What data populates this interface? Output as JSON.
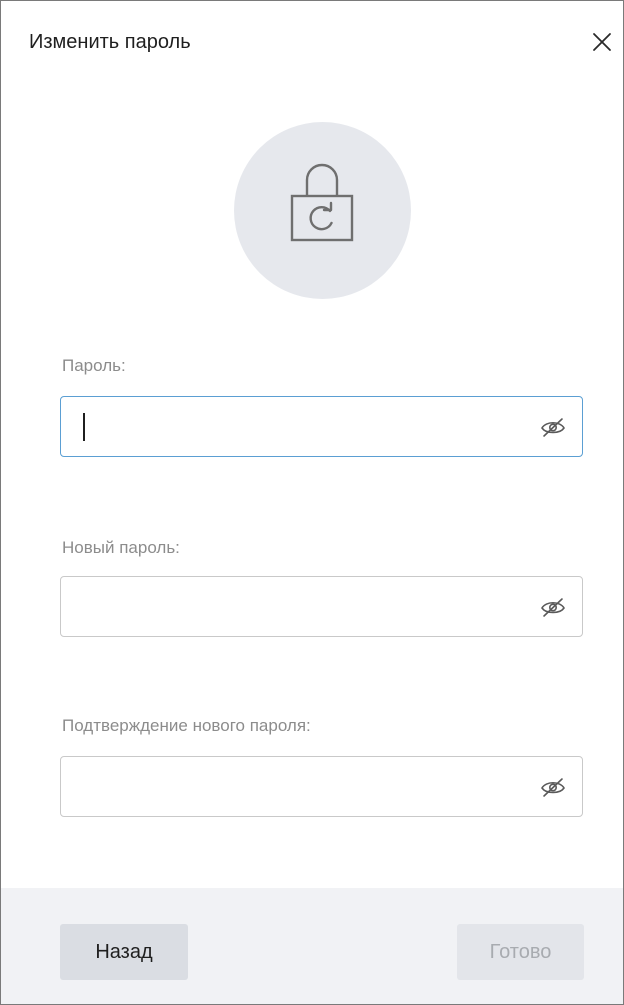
{
  "dialog": {
    "title": "Изменить пароль",
    "close_icon": "close-icon"
  },
  "header_icon": {
    "icon": "lock-refresh-icon"
  },
  "fields": [
    {
      "label": "Пароль:",
      "value": "",
      "placeholder": "",
      "focused": true,
      "toggle_icon": "eye-hidden-icon"
    },
    {
      "label": "Новый пароль:",
      "value": "",
      "placeholder": "",
      "focused": false,
      "toggle_icon": "eye-hidden-icon"
    },
    {
      "label": "Подтверждение нового пароля:",
      "value": "",
      "placeholder": "",
      "focused": false,
      "toggle_icon": "eye-hidden-icon"
    }
  ],
  "footer": {
    "back_label": "Назад",
    "done_label": "Готово",
    "done_enabled": false
  },
  "colors": {
    "focus_border": "#5b9fd3",
    "icon_circle": "#e6e8ed",
    "footer_bg": "#f1f2f5",
    "label_gray": "#8c8c8c"
  }
}
